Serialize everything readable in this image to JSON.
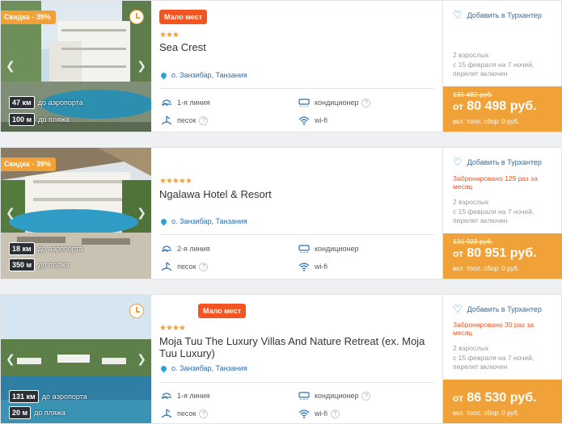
{
  "hotels": [
    {
      "discount": "Скидка - 39%",
      "few_left": "Мало мест",
      "stars": "★★★",
      "name": "Sea Crest",
      "location": "о. Занзибар, Танзания",
      "airport_distance": "47 км",
      "airport_label": "до аэропорта",
      "beach_distance": "100 м",
      "beach_label": "до пляжа",
      "line": "1-я линия",
      "ac": "кондиционер",
      "beach_type": "песок",
      "wifi": "wi-fi",
      "favorite": "Добавить в Турхантер",
      "booked": "",
      "guests": "2 взрослых",
      "dates": "с 15 февраля на 7 ночей,",
      "flight": "перелет включен",
      "old_price": "131 482 руб.",
      "price_from": "от",
      "price": "80 498 руб.",
      "fee": "вкл. топл. сбор: 0 руб."
    },
    {
      "discount": "Скидка - 39%",
      "few_left": "",
      "stars": "★★★★★",
      "name": "Ngalawa Hotel & Resort",
      "location": "о. Занзибар, Танзания",
      "airport_distance": "18 км",
      "airport_label": "до аэропорта",
      "beach_distance": "350 м",
      "beach_label": "до пляжа",
      "line": "2-я линия",
      "ac": "кондиционер",
      "beach_type": "песок",
      "wifi": "wi-fi",
      "favorite": "Добавить в Турхантер",
      "booked": "Забронировано 129 раз за месяц",
      "guests": "2 взрослых",
      "dates": "с 15 февраля на 7 ночей,",
      "flight": "перелет включен",
      "old_price": "131 923 руб.",
      "price_from": "от",
      "price": "80 951 руб.",
      "fee": "вкл. топл. сбор: 0 руб."
    },
    {
      "discount": "",
      "few_left": "Мало мест",
      "stars": "★★★★",
      "name": "Moja Tuu The Luxury Villas And Nature Retreat (ex. Moja Tuu Luxury)",
      "location": "о. Занзибар, Танзания",
      "airport_distance": "131 км",
      "airport_label": "до аэропорта",
      "beach_distance": "20 м",
      "beach_label": "до пляжа",
      "line": "1-я линия",
      "ac": "кондиционер",
      "beach_type": "песок",
      "wifi": "wi-fi",
      "favorite": "Добавить в Турхантер",
      "booked": "Забронировано 30 раз за месяц",
      "guests": "2 взрослых",
      "dates": "с 15 февраля на 7 ночей,",
      "flight": "перелет включен",
      "old_price": "",
      "price_from": "от",
      "price": "86 530 руб.",
      "fee": "вкл. топл. сбор: 0 руб."
    }
  ],
  "icons": [
    "clock-icon",
    "pin-icon",
    "beach-line-icon",
    "air-conditioner-icon",
    "sand-icon",
    "wifi-icon",
    "heart-icon",
    "chevron-left-icon",
    "chevron-right-icon"
  ],
  "colors": {
    "accent": "#f0a137",
    "badge": "#f45421",
    "link": "#2a6fb3"
  }
}
